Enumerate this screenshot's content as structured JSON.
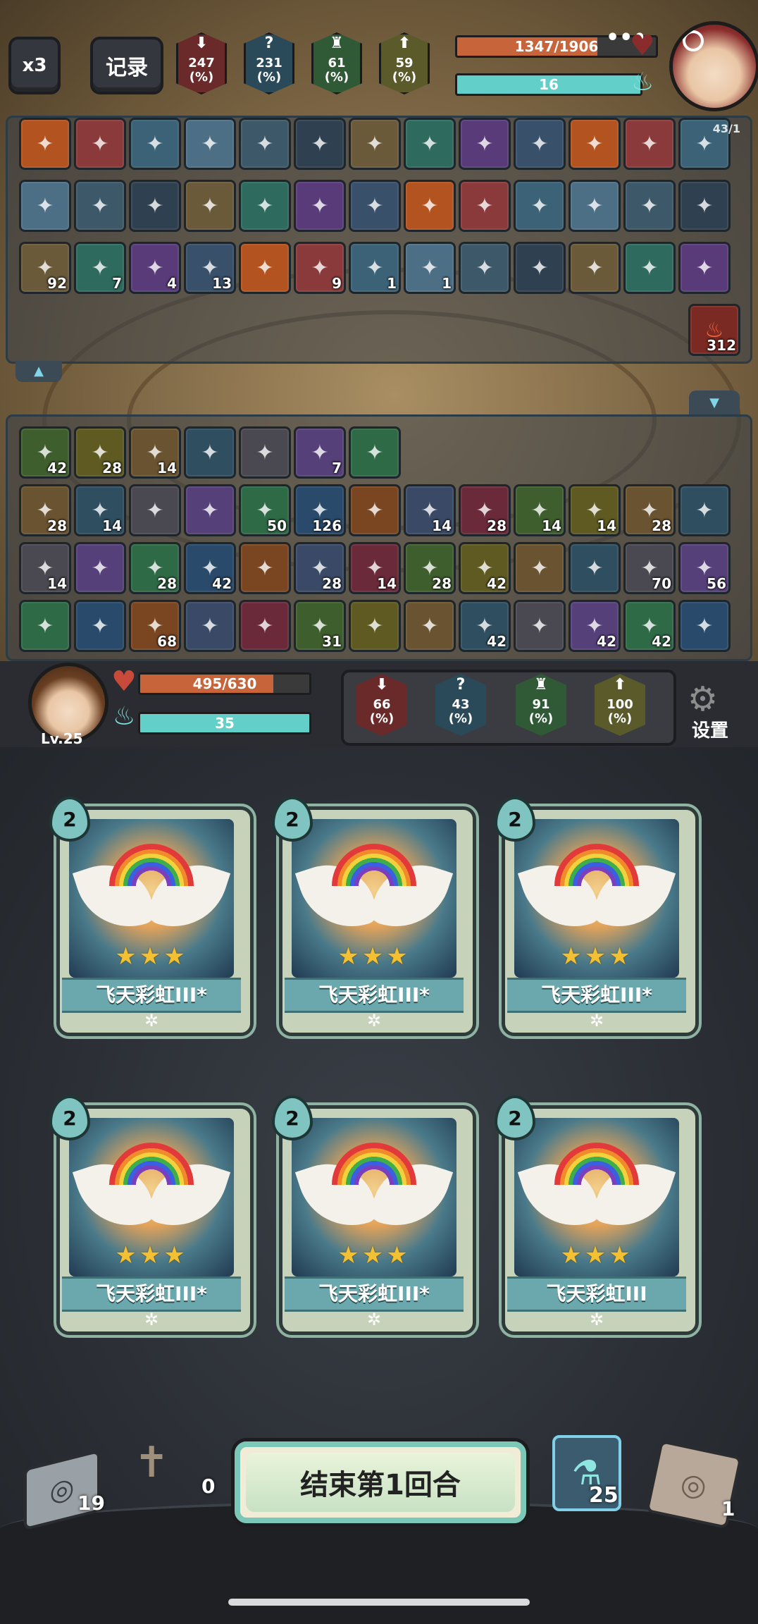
{
  "top": {
    "speed_label": "x3",
    "record_label": "记录",
    "enemy_stats": [
      {
        "name": "attack",
        "value": "247",
        "unit": "(%)",
        "color": "#6b2a2a",
        "icon": "sword-down-icon"
      },
      {
        "name": "crit",
        "value": "231",
        "unit": "(%)",
        "color": "#2a4a5a",
        "icon": "question-icon"
      },
      {
        "name": "defense",
        "value": "61",
        "unit": "(%)",
        "color": "#2f5a35",
        "icon": "tower-icon"
      },
      {
        "name": "speed",
        "value": "59",
        "unit": "(%)",
        "color": "#5a5a2a",
        "icon": "arrow-up-icon"
      }
    ],
    "enemy_hp_text": "1347/1906",
    "enemy_hp_fraction": 0.707,
    "enemy_mana_text": "16",
    "enemy_mana_fraction": 1.0,
    "dots": "•••"
  },
  "enemy_panel": {
    "counter": "43/1",
    "rows": [
      [
        "",
        "",
        "",
        "",
        "",
        "",
        "",
        "",
        "",
        "",
        "",
        "",
        ""
      ],
      [
        "",
        "",
        "",
        "",
        "",
        "",
        "",
        "",
        "",
        "",
        "",
        "",
        ""
      ],
      [
        "92",
        "7",
        "4",
        "13",
        "",
        "9",
        "1",
        "1",
        "",
        "",
        "",
        "",
        ""
      ]
    ],
    "extra_count": "312",
    "collapse_icon": "chevron-up-icon"
  },
  "player_panel": {
    "expand_icon": "chevron-down-icon",
    "rows": [
      [
        "42",
        "28",
        "14",
        "",
        "",
        "7",
        ""
      ],
      [
        "28",
        "14",
        "",
        "",
        "50",
        "126",
        "",
        "14",
        "28",
        "14",
        "14",
        "28",
        ""
      ],
      [
        "14",
        "",
        "28",
        "42",
        "",
        "28",
        "14",
        "28",
        "42",
        "",
        "",
        "70",
        "56"
      ],
      [
        "",
        "",
        "68",
        "",
        "",
        "31",
        "",
        "",
        "42",
        "",
        "42",
        "42",
        ""
      ]
    ]
  },
  "player": {
    "level": "Lv.25",
    "hp_text": "495/630",
    "hp_fraction": 0.786,
    "mana_text": "35",
    "mana_fraction": 1.0,
    "stats": [
      {
        "value": "66",
        "unit": "(%)",
        "color": "#6b2a2a",
        "icon": "sword-down-icon"
      },
      {
        "value": "43",
        "unit": "(%)",
        "color": "#2a4a5a",
        "icon": "question-icon"
      },
      {
        "value": "91",
        "unit": "(%)",
        "color": "#2f5a35",
        "icon": "tower-icon"
      },
      {
        "value": "100",
        "unit": "(%)",
        "color": "#5a5a2a",
        "icon": "arrow-up-icon"
      }
    ],
    "settings_label": "设置"
  },
  "hand": [
    {
      "cost": "2",
      "name": "飞天彩虹III*",
      "stars": "★★★"
    },
    {
      "cost": "2",
      "name": "飞天彩虹III*",
      "stars": "★★★"
    },
    {
      "cost": "2",
      "name": "飞天彩虹III*",
      "stars": "★★★"
    },
    {
      "cost": "2",
      "name": "飞天彩虹III*",
      "stars": "★★★"
    },
    {
      "cost": "2",
      "name": "飞天彩虹III*",
      "stars": "★★★"
    },
    {
      "cost": "2",
      "name": "飞天彩虹III",
      "stars": "★★★"
    }
  ],
  "bottom": {
    "draw_pile": "19",
    "discard_pile": "0",
    "end_turn_label": "结束第1回合",
    "potion_count": "25",
    "exhaust_pile": "1"
  }
}
